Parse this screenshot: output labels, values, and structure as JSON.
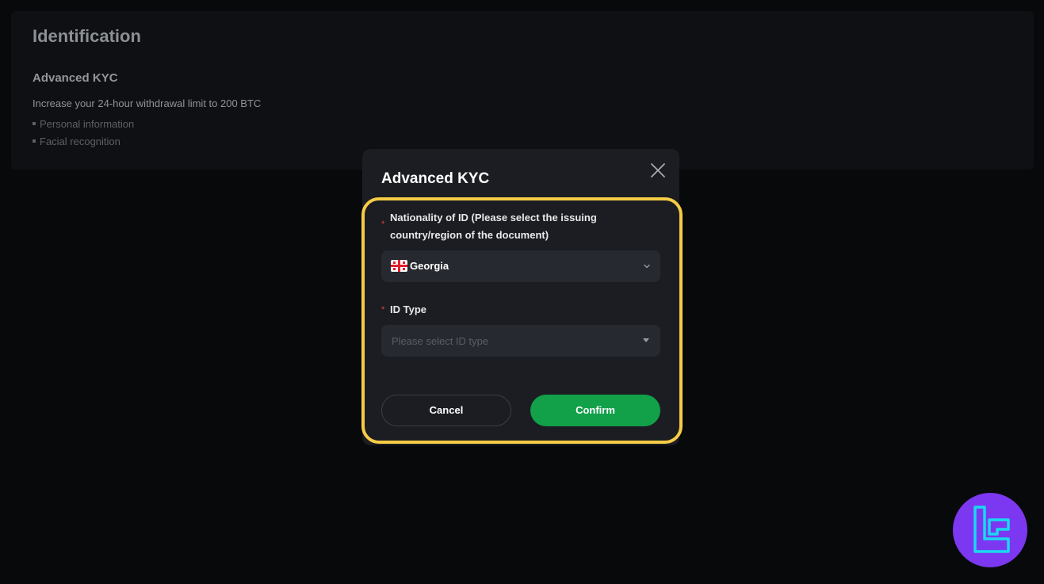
{
  "background": {
    "title": "Identification",
    "section_title": "Advanced KYC",
    "description": "Increase your 24-hour withdrawal limit to 200 BTC",
    "requirements": [
      "Personal information",
      "Facial recognition"
    ]
  },
  "modal": {
    "title": "Advanced KYC",
    "nationality": {
      "required_mark": "*",
      "label": "Nationality of ID (Please select the issuing country/region of the document)",
      "selected_value": "Georgia",
      "flag_icon": "georgia-flag-icon"
    },
    "id_type": {
      "required_mark": "*",
      "label": "ID Type",
      "placeholder": "Please select ID type"
    },
    "cancel_label": "Cancel",
    "confirm_label": "Confirm"
  },
  "colors": {
    "confirm": "#12a049",
    "highlight": "#f7cc45",
    "required": "#e0433f",
    "logo": "#7c38f0",
    "logo_accent": "#19d8f0"
  }
}
